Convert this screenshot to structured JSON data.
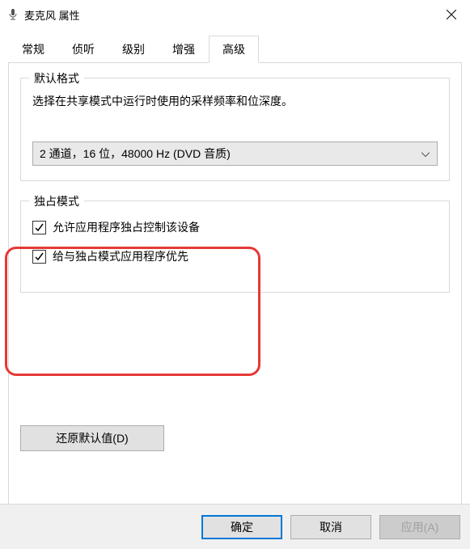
{
  "window": {
    "title": "麦克风 属性"
  },
  "tabs": {
    "t0": "常规",
    "t1": "侦听",
    "t2": "级别",
    "t3": "增强",
    "t4": "高级"
  },
  "default_format": {
    "legend": "默认格式",
    "desc": "选择在共享模式中运行时使用的采样频率和位深度。",
    "selected": "2 通道，16 位，48000 Hz (DVD 音质)"
  },
  "exclusive": {
    "legend": "独占模式",
    "cb1": "允许应用程序独占控制该设备",
    "cb2": "给与独占模式应用程序优先"
  },
  "buttons": {
    "restore": "还原默认值(D)",
    "ok": "确定",
    "cancel": "取消",
    "apply": "应用(A)"
  }
}
